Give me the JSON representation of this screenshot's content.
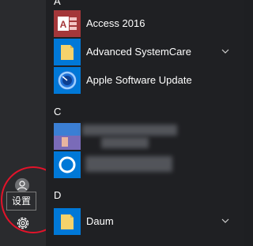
{
  "sections": [
    {
      "letter": "A",
      "items": [
        {
          "label": "Access 2016",
          "icon": "access-icon",
          "color": "#a4373a",
          "expandable": false
        },
        {
          "label": "Advanced SystemCare",
          "icon": "folder-icon",
          "color": "#0078d7",
          "expandable": true
        },
        {
          "label": "Apple Software Update",
          "icon": "apple-update-icon",
          "color": "#0078d7",
          "expandable": false
        }
      ]
    },
    {
      "letter": "C",
      "items": []
    },
    {
      "letter": "D",
      "items": [
        {
          "label": "Daum",
          "icon": "folder-icon",
          "color": "#0078d7",
          "expandable": true
        }
      ]
    }
  ],
  "rail": {
    "tooltip": "设置",
    "annotation_color": "#e3132a"
  }
}
